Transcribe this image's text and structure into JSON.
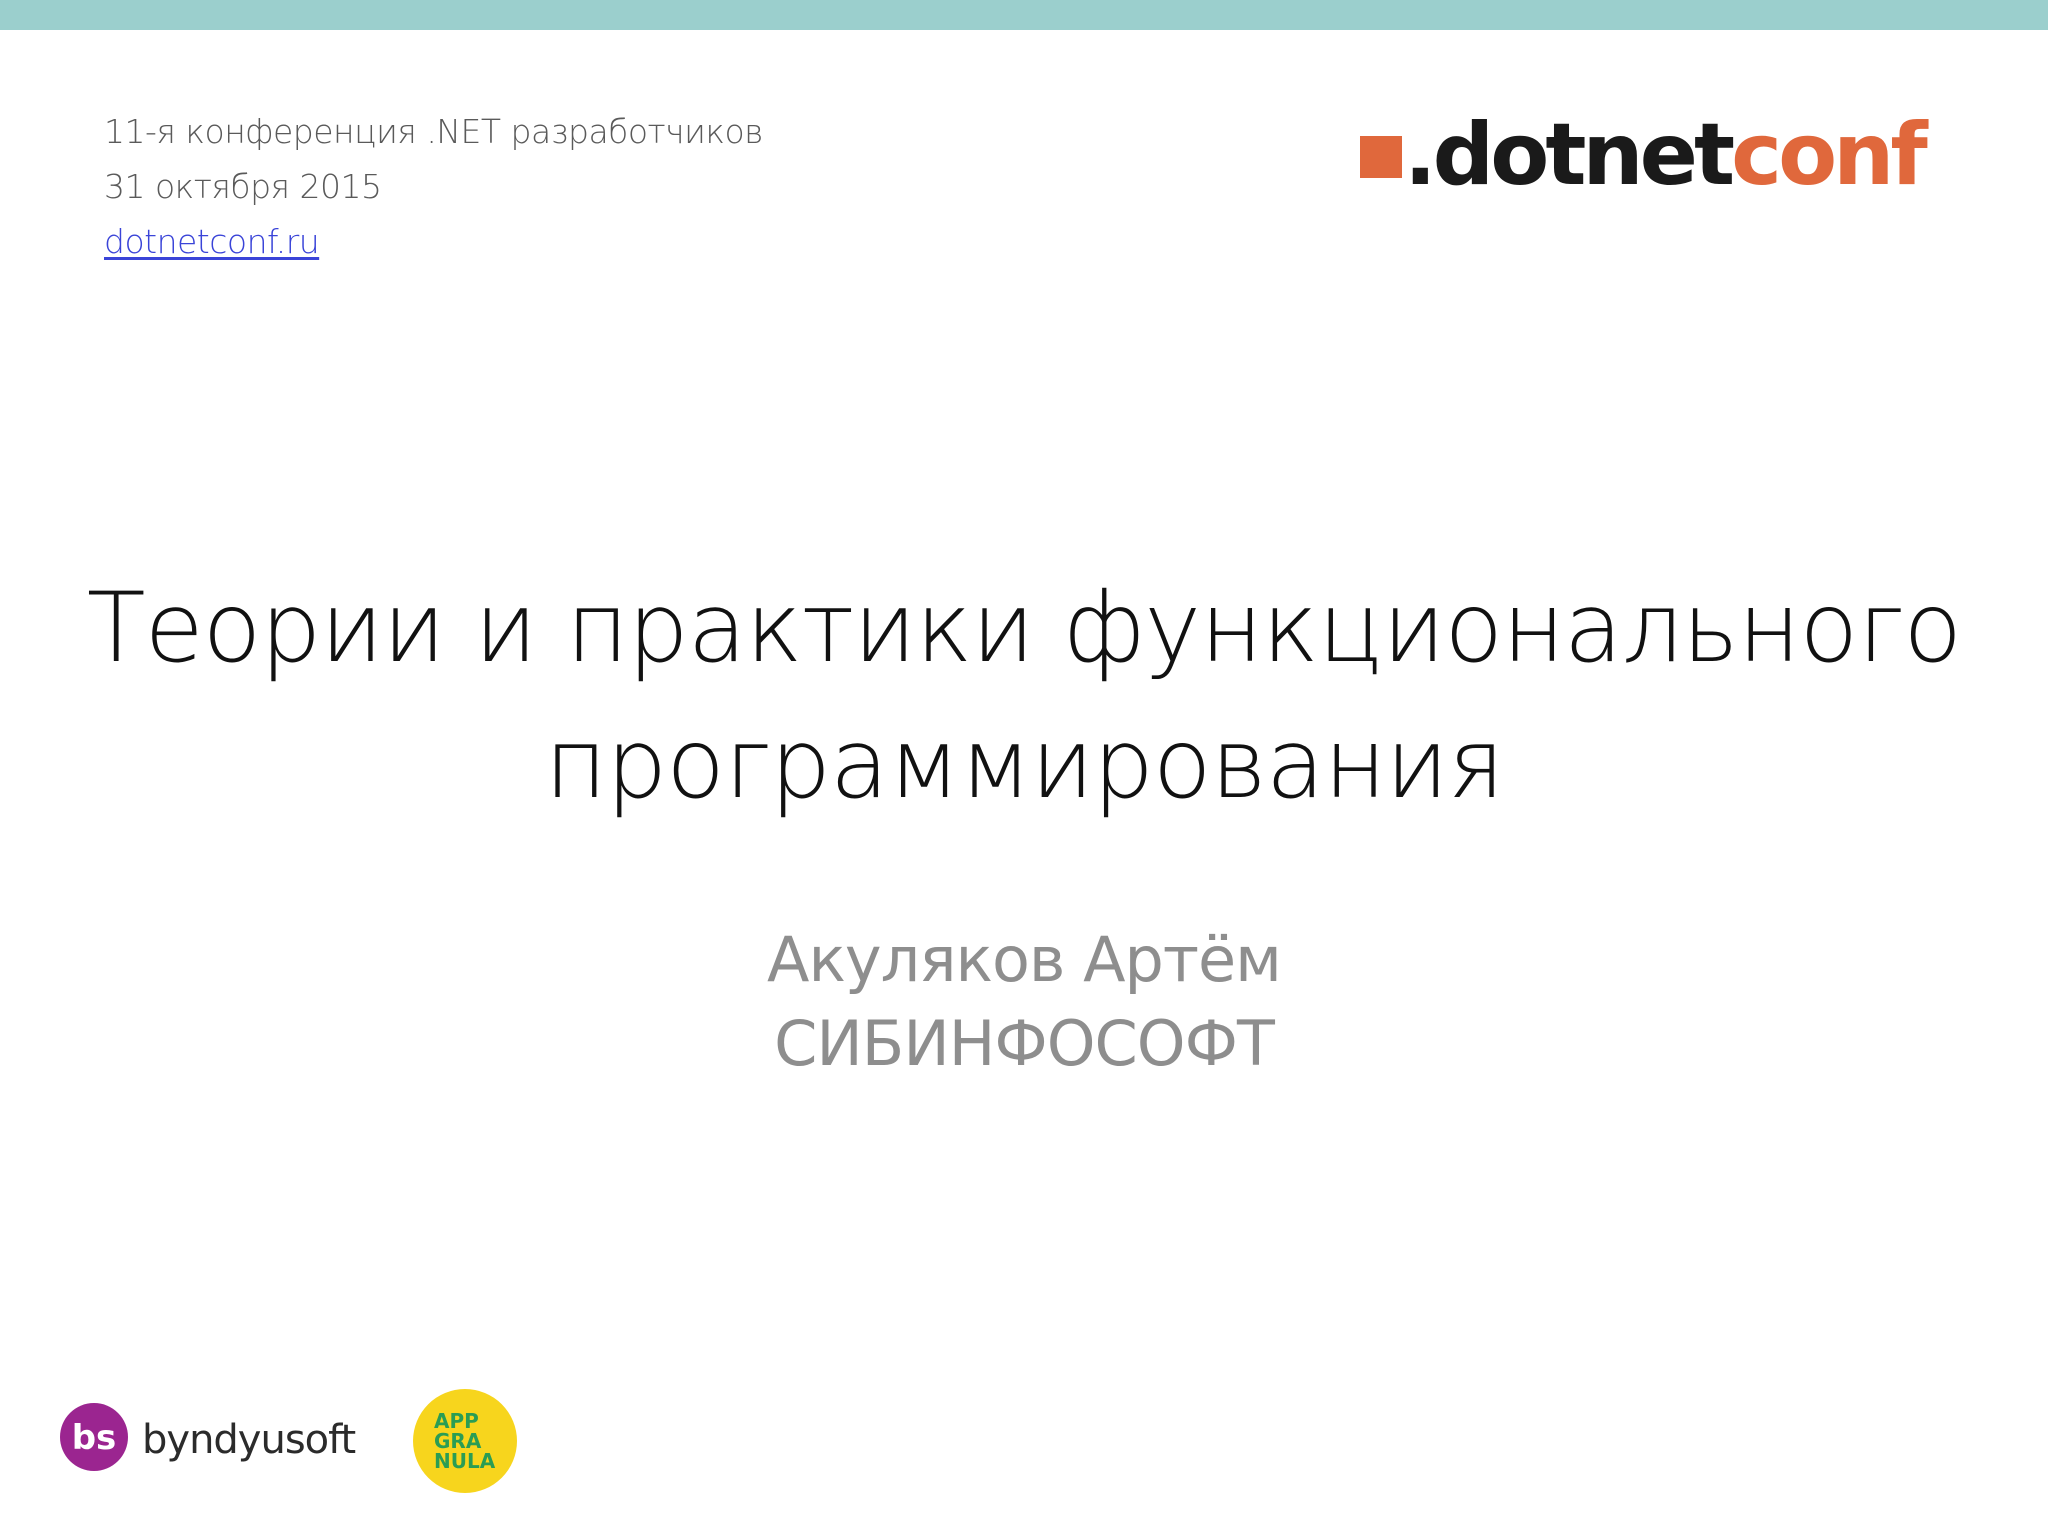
{
  "header": {
    "conference_line": "11-я конференция .NET разработчиков",
    "date_line": "31 октября 2015",
    "site_link": "dotnetconf.ru"
  },
  "logos": {
    "dotnetconf": {
      "text_dark": ".dotnet",
      "text_accent": "conf",
      "accent_color": "#e0683c"
    },
    "byndyusoft": {
      "badge": "bs",
      "text": "byndyusoft",
      "badge_color": "#9b2590"
    },
    "appgranula": {
      "lines": [
        "APP",
        "GRA",
        "NULA"
      ],
      "circle_color": "#f7d51d",
      "text_color": "#2a9d54"
    }
  },
  "title": {
    "line1": "Теории и практики функционального",
    "line2": "программирования"
  },
  "author": {
    "name": "Акуляков Артём",
    "company": "СИБИНФОСОФТ"
  },
  "colors": {
    "top_bar": "#9bcfcd"
  }
}
